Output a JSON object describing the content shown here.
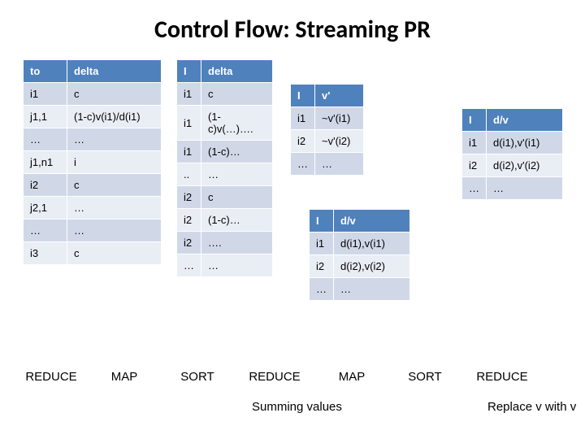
{
  "title": "Control Flow: Streaming PR",
  "tables": {
    "t1": {
      "headers": [
        "to",
        "delta"
      ],
      "rows": [
        [
          "i1",
          "c"
        ],
        [
          "j1,1",
          "(1-c)v(i1)/d(i1)"
        ],
        [
          "…",
          "…"
        ],
        [
          "j1,n1",
          "i"
        ],
        [
          "i2",
          "c"
        ],
        [
          "j2,1",
          "…"
        ],
        [
          "…",
          "…"
        ],
        [
          "i3",
          "c"
        ]
      ]
    },
    "t2": {
      "headers": [
        "I",
        "delta"
      ],
      "rows": [
        [
          "i1",
          "c"
        ],
        [
          "i1",
          "(1-c)v(…)…."
        ],
        [
          "i1",
          "(1-c)…"
        ],
        [
          "..",
          "…"
        ],
        [
          "i2",
          "c"
        ],
        [
          "i2",
          "(1-c)…"
        ],
        [
          "i2",
          "…."
        ],
        [
          "…",
          "…"
        ]
      ]
    },
    "t3": {
      "headers": [
        "I",
        "v'"
      ],
      "rows": [
        [
          "i1",
          "~v'(i1)"
        ],
        [
          "i2",
          "~v'(i2)"
        ],
        [
          "…",
          "…"
        ]
      ]
    },
    "t4": {
      "headers": [
        "I",
        "d/v"
      ],
      "rows": [
        [
          "i1",
          "d(i1),v'(i1)"
        ],
        [
          "i2",
          "d(i2),v'(i2)"
        ],
        [
          "…",
          "…"
        ]
      ]
    },
    "t5": {
      "headers": [
        "I",
        "d/v"
      ],
      "rows": [
        [
          "i1",
          "d(i1),v(i1)"
        ],
        [
          "i2",
          "d(i2),v(i2)"
        ],
        [
          "…",
          "…"
        ]
      ]
    }
  },
  "stages": [
    "REDUCE",
    "MAP",
    "SORT",
    "REDUCE",
    "MAP",
    "SORT",
    "REDUCE"
  ],
  "captions": {
    "c1": "Summing values",
    "c2": "Replace v with v"
  }
}
